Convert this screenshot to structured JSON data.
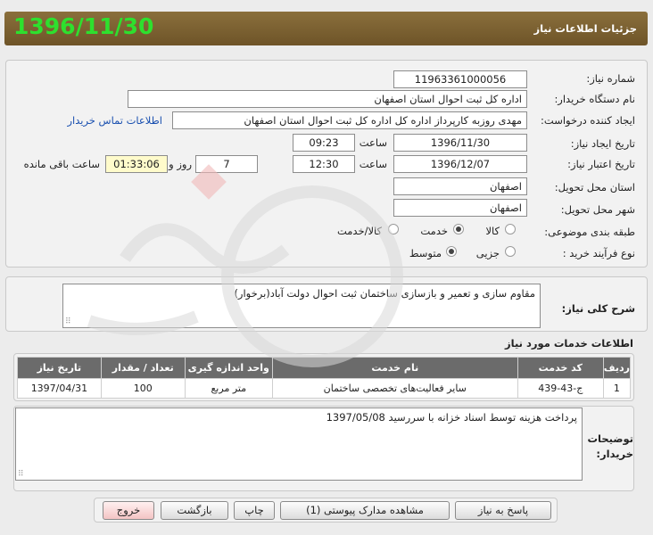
{
  "header": {
    "date": "1396/11/30",
    "title": "جزئیات اطلاعات نیاز"
  },
  "form": {
    "need_number_label": "شماره نیاز:",
    "need_number": "11963361000056",
    "buyer_org_label": "نام دستگاه خریدار:",
    "buyer_org": "اداره کل ثبت احوال استان اصفهان",
    "requester_label": "ایجاد کننده درخواست:",
    "requester": "مهدی روزبه کارپرداز اداره کل اداره کل ثبت احوال استان اصفهان",
    "buyer_contact_link": "اطلاعات تماس خریدار",
    "created_date_label": "تاریخ ایجاد نیاز:",
    "created_date": "1396/11/30",
    "time_label": "ساعت",
    "created_time": "09:23",
    "validity_date_label": "تاریخ اعتبار نیاز:",
    "validity_date": "1396/12/07",
    "validity_time": "12:30",
    "days_value": "7",
    "days_label": "روز و",
    "remaining_time": "01:33:06",
    "remaining_label": "ساعت باقی مانده",
    "delivery_province_label": "استان محل تحویل:",
    "delivery_province": "اصفهان",
    "delivery_city_label": "شهر محل تحویل:",
    "delivery_city": "اصفهان",
    "category_label": "طبقه بندی موضوعی:",
    "category_options": [
      "کالا",
      "خدمت",
      "کالا/خدمت"
    ],
    "category_selected": "خدمت",
    "process_label": "نوع فرآیند خرید :",
    "process_options": [
      "جزیی",
      "متوسط"
    ],
    "process_selected": "متوسط"
  },
  "description": {
    "label": "شرح کلی نیاز:",
    "text": "مقاوم سازی و تعمیر و بازسازی ساختمان ثبت احوال دولت آباد(برخوار)"
  },
  "services": {
    "section_title": "اطلاعات خدمات مورد نیاز",
    "columns": [
      "ردیف",
      "کد خدمت",
      "نام خدمت",
      "واحد اندازه گیری",
      "تعداد / مقدار",
      "تاریخ نیاز"
    ],
    "rows": [
      [
        "1",
        "ج-43-439",
        "سایر فعالیت‌های تخصصی ساختمان",
        "متر مربع",
        "100",
        "1397/04/31"
      ]
    ]
  },
  "buyer_notes": {
    "label_line1": "توضیحات",
    "label_line2": "خریدار:",
    "text": "پرداخت هزینه توسط اسناد خزانه با سررسید 1397/05/08"
  },
  "buttons": {
    "reply": "پاسخ به نیاز",
    "attachments": "مشاهده مدارک پیوستی (1)",
    "print": "چاپ",
    "back": "بازگشت",
    "exit": "خروج"
  }
}
